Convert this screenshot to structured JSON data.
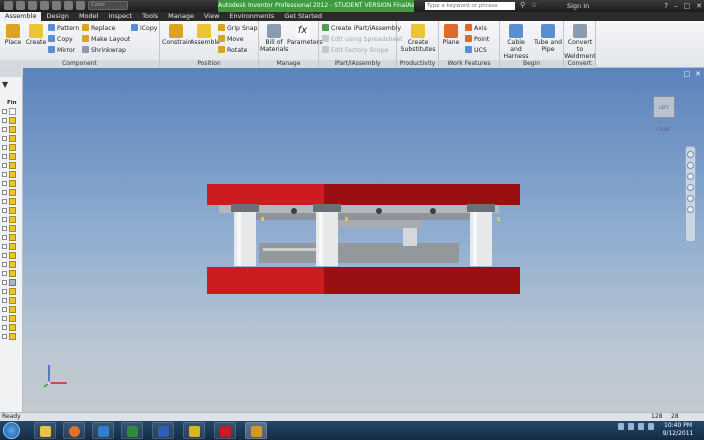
{
  "title_bar": {
    "color_box": "Color",
    "app_title": "Autodesk Inventor Professional 2012 - STUDENT VERSION   FinalAssy",
    "search_placeholder": "Type a keyword or phrase",
    "sign_in": "Sign In"
  },
  "menu_tabs": [
    "Assemble",
    "Design",
    "Model",
    "Inspect",
    "Tools",
    "Manage",
    "View",
    "Environments",
    "Get Started"
  ],
  "ribbon": {
    "place": "Place",
    "create": "Create",
    "pattern": "Pattern",
    "copy": "Copy",
    "mirror": "Mirror",
    "replace": "Replace",
    "make_layout": "Make Layout",
    "shrinkwrap": "Shrinkwrap",
    "icopy": "iCopy",
    "constrain": "Constrain",
    "assemble": "Assemble",
    "grip_snap": "Grip Snap",
    "move": "Move",
    "rotate": "Rotate",
    "bill_line1": "Bill of",
    "bill_line2": "Materials",
    "parameters": "Parameters",
    "create_ipart": "Create iPart/iAssembly",
    "edit_spreadsheet": "Edit using Spreadsheet",
    "edit_factory": "Edit Factory Scope",
    "create_sub_line1": "Create",
    "create_sub_line2": "Substitutes",
    "plane": "Plane",
    "axis": "Axis",
    "point": "Point",
    "ucs": "UCS",
    "cable_line1": "Cable and",
    "cable_line2": "Harness",
    "tube_line1": "Tube and",
    "tube_line2": "Pipe",
    "convert_line1": "Convert to",
    "convert_line2": "Weldment"
  },
  "panels": {
    "component": "Component",
    "position": "Position",
    "manage": "Manage",
    "ipart": "iPart/iAssembly",
    "productivity": "Productivity",
    "work_features": "Work Features",
    "begin": "Begin",
    "convert": "Convert"
  },
  "model_browser": {
    "file_label": "Fin"
  },
  "viewport": {
    "viewcube_label": "LEFT  FRONT"
  },
  "status": {
    "text": "Ready",
    "value1": "128",
    "value2": "28"
  },
  "clock": {
    "time": "10:40 PM",
    "date": "9/12/2011"
  },
  "colors": {
    "accent_green": "#3f9b3f",
    "die_plate_red": "#c0181c",
    "viewport_top": "#5a82bc",
    "viewport_bottom": "#c4cad0"
  },
  "icons": {
    "taskbar": [
      "start-orb-icon",
      "file-explorer-icon",
      "firefox-icon",
      "media-icon",
      "excel-icon",
      "word-icon",
      "solidworks-icon",
      "acrobat-icon",
      "inventor-icon"
    ]
  }
}
